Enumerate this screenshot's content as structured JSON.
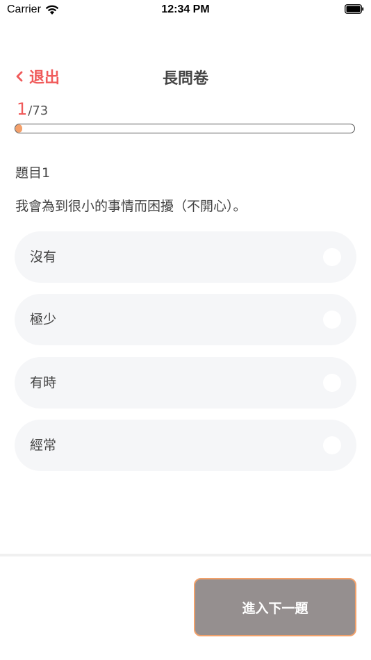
{
  "status_bar": {
    "carrier": "Carrier",
    "time": "12:34 PM"
  },
  "header": {
    "back_label": "退出",
    "title": "長問卷"
  },
  "progress": {
    "current": "1",
    "separator": "/",
    "total": "73",
    "fraction": 0.0137
  },
  "question": {
    "number_label": "題目1",
    "text": "我會為到很小的事情而困擾（不開心）。"
  },
  "options": [
    {
      "label": "沒有"
    },
    {
      "label": "極少"
    },
    {
      "label": "有時"
    },
    {
      "label": "經常"
    }
  ],
  "footer": {
    "next_label": "進入下一題"
  },
  "colors": {
    "accent": "#f05a5a",
    "progress_fill": "#f4a06a",
    "option_bg": "#f5f6f8",
    "next_button_bg": "#958f8f",
    "next_button_border": "#f0a06a"
  }
}
